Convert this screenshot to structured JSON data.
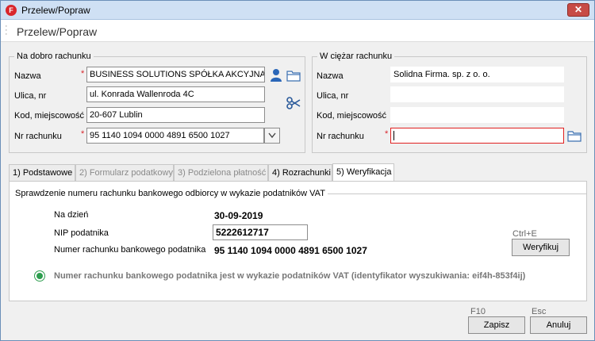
{
  "window": {
    "title": "Przelew/Popraw",
    "app_icon": "F",
    "close_glyph": "✕"
  },
  "header": {
    "title": "Przelew/Popraw"
  },
  "recipient": {
    "legend": "Na dobro rachunku",
    "name_label": "Nazwa",
    "name_value": "BUSINESS SOLUTIONS SPÓŁKA AKCYJNA",
    "street_label": "Ulica, nr",
    "street_value": "ul. Konrada Wallenroda 4C",
    "postal_label": "Kod, miejscowość",
    "postal_value": "20-607 Lublin",
    "account_label": "Nr rachunku",
    "account_value": "95 1140 1094 0000 4891 6500 1027",
    "required_mark": "*"
  },
  "payer": {
    "legend": "W ciężar rachunku",
    "name_label": "Nazwa",
    "name_value": "Solidna Firma. sp. z o. o.",
    "street_label": "Ulica, nr",
    "street_value": "",
    "postal_label": "Kod, miejscowość",
    "postal_value": "",
    "account_label": "Nr rachunku",
    "account_value": "",
    "required_mark": "*"
  },
  "tabs": [
    {
      "label": "1) Podstawowe",
      "state": "normal"
    },
    {
      "label": "2) Formularz podatkowy",
      "state": "disabled"
    },
    {
      "label": "3) Podzielona płatność",
      "state": "disabled"
    },
    {
      "label": "4) Rozrachunki",
      "state": "normal"
    },
    {
      "label": "5) Weryfikacja",
      "state": "active"
    }
  ],
  "verification": {
    "legend": "Sprawdzenie numeru rachunku bankowego odbiorcy w wykazie podatników VAT",
    "date_label": "Na dzień",
    "date_value": "30-09-2019",
    "nip_label": "NIP podatnika",
    "nip_value": "5222612717",
    "account_label": "Numer rachunku bankowego podatnika",
    "account_value": "95 1140 1094 0000 4891 6500 1027",
    "verify_shortcut": "Ctrl+E",
    "verify_label": "Weryfikuj",
    "result_text": "Numer rachunku bankowego podatnika jest w wykazie podatników VAT (identyfikator wyszukiwania: eif4h-853f4ij)",
    "result_color": "#2e9e4f"
  },
  "footer": {
    "save_shortcut": "F10",
    "save_label": "Zapisz",
    "cancel_shortcut": "Esc",
    "cancel_label": "Anuluj"
  },
  "colors": {
    "accent_red": "#d9262c",
    "titlebar": "#cfe0f4",
    "person_icon": "#2a66b8"
  }
}
